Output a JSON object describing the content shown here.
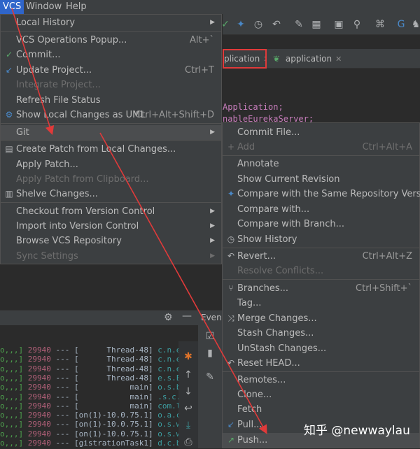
{
  "menubar": {
    "items": [
      "VCS",
      "Window",
      "Help"
    ]
  },
  "toolbar": {
    "icons": [
      "check-icon",
      "update-icon",
      "history-icon",
      "revert-icon",
      "wrench-icon",
      "project-structure-icon",
      "terminal-icon",
      "search-icon",
      "translate-icon",
      "google-translate-icon",
      "bear-icon"
    ]
  },
  "editor": {
    "tabs": [
      {
        "label": "plication",
        "highlighted": true
      },
      {
        "label": "application",
        "highlighted": false
      }
    ],
    "code": [
      {
        "text": "Application;"
      },
      {
        "text": "nableEurekaServer;"
      }
    ]
  },
  "vcs_menu": {
    "items": [
      {
        "label": "Local History",
        "submenu": true
      },
      {
        "label": "VCS Operations Popup...",
        "shortcut": "Alt+`"
      },
      {
        "label": "Commit...",
        "icon": "check-icon"
      },
      {
        "label": "Update Project...",
        "shortcut": "Ctrl+T",
        "icon": "update-arrow-icon"
      },
      {
        "label": "Integrate Project...",
        "disabled": true
      },
      {
        "label": "Refresh File Status"
      },
      {
        "label": "Show Local Changes as UML",
        "shortcut": "Ctrl+Alt+Shift+D",
        "icon": "uml-diagram-icon"
      },
      {
        "label": "Git",
        "submenu": true,
        "highlighted": true
      },
      {
        "label": "Create Patch from Local Changes...",
        "icon": "patch-icon"
      },
      {
        "label": "Apply Patch..."
      },
      {
        "label": "Apply Patch from Clipboard...",
        "disabled": true
      },
      {
        "label": "Shelve Changes...",
        "icon": "shelve-icon"
      },
      {
        "label": "Checkout from Version Control",
        "submenu": true
      },
      {
        "label": "Import into Version Control",
        "submenu": true
      },
      {
        "label": "Browse VCS Repository",
        "submenu": true
      },
      {
        "label": "Sync Settings",
        "submenu": true,
        "disabled": true
      }
    ]
  },
  "git_menu": {
    "items": [
      {
        "label": "Commit File..."
      },
      {
        "label": "Add",
        "shortcut": "Ctrl+Alt+A",
        "disabled": true,
        "icon": "plus-icon"
      },
      {
        "label": "Annotate"
      },
      {
        "label": "Show Current Revision"
      },
      {
        "label": "Compare with the Same Repository Version",
        "icon": "compare-icon"
      },
      {
        "label": "Compare with..."
      },
      {
        "label": "Compare with Branch..."
      },
      {
        "label": "Show History",
        "icon": "history-icon"
      },
      {
        "label": "Revert...",
        "shortcut": "Ctrl+Alt+Z",
        "icon": "revert-icon"
      },
      {
        "label": "Resolve Conflicts...",
        "disabled": true
      },
      {
        "label": "Branches...",
        "shortcut": "Ctrl+Shift+`",
        "icon": "branch-icon"
      },
      {
        "label": "Tag..."
      },
      {
        "label": "Merge Changes...",
        "icon": "merge-icon"
      },
      {
        "label": "Stash Changes..."
      },
      {
        "label": "UnStash Changes..."
      },
      {
        "label": "Reset HEAD...",
        "icon": "reset-icon"
      },
      {
        "label": "Remotes..."
      },
      {
        "label": "Clone..."
      },
      {
        "label": "Fetch"
      },
      {
        "label": "Pull...",
        "icon": "pull-arrow-icon"
      },
      {
        "label": "Push...",
        "icon": "push-arrow-icon",
        "highlighted": true
      }
    ]
  },
  "console": {
    "header_label": "Even",
    "lines": [
      {
        "level": "o,,,]",
        "pid": "29940",
        "dashes": "---",
        "thread": "[      Thread-48]",
        "logger": "c.n.e.r.P"
      },
      {
        "level": "o,,,]",
        "pid": "29940",
        "dashes": "---",
        "thread": "[      Thread-48]",
        "logger": "c.n.e.r.P"
      },
      {
        "level": "o,,,]",
        "pid": "29940",
        "dashes": "---",
        "thread": "[      Thread-48]",
        "logger": "c.n.e.r.P"
      },
      {
        "level": "o,,,]",
        "pid": "29940",
        "dashes": "---",
        "thread": "[      Thread-48]",
        "logger": "e.s.Eurek"
      },
      {
        "level": "o,,,]",
        "pid": "29940",
        "dashes": "---",
        "thread": "[           main]",
        "logger": "o.s.b.w.e"
      },
      {
        "level": "o,,,]",
        "pid": "29940",
        "dashes": "---",
        "thread": "[           main]",
        "logger": ".s.c.n.e."
      },
      {
        "level": "o,,,]",
        "pid": "29940",
        "dashes": "---",
        "thread": "[           main]",
        "logger": "com.lw.eu"
      },
      {
        "level": "o,,,]",
        "pid": "29940",
        "dashes": "---",
        "thread": "[on(1)-10.0.75.1]",
        "logger": "o.a.c.c.C"
      },
      {
        "level": "o,,,]",
        "pid": "29940",
        "dashes": "---",
        "thread": "[on(1)-10.0.75.1]",
        "logger": "o.s.web.s"
      },
      {
        "level": "o,,,]",
        "pid": "29940",
        "dashes": "---",
        "thread": "[on(1)-10.0.75.1]",
        "logger": "o.s.web.s"
      },
      {
        "level": "o,,,]",
        "pid": "29940",
        "dashes": "---",
        "thread": "[gistrationTask1]",
        "logger": "d.c.b.a.c"
      }
    ]
  },
  "watermark": "知乎 @newwaylau",
  "colors": {
    "menu_bg": "#3c3f41",
    "selection": "#2f65ca",
    "highlight": "#4b4d4f",
    "annotation_red": "#e03a3a"
  }
}
